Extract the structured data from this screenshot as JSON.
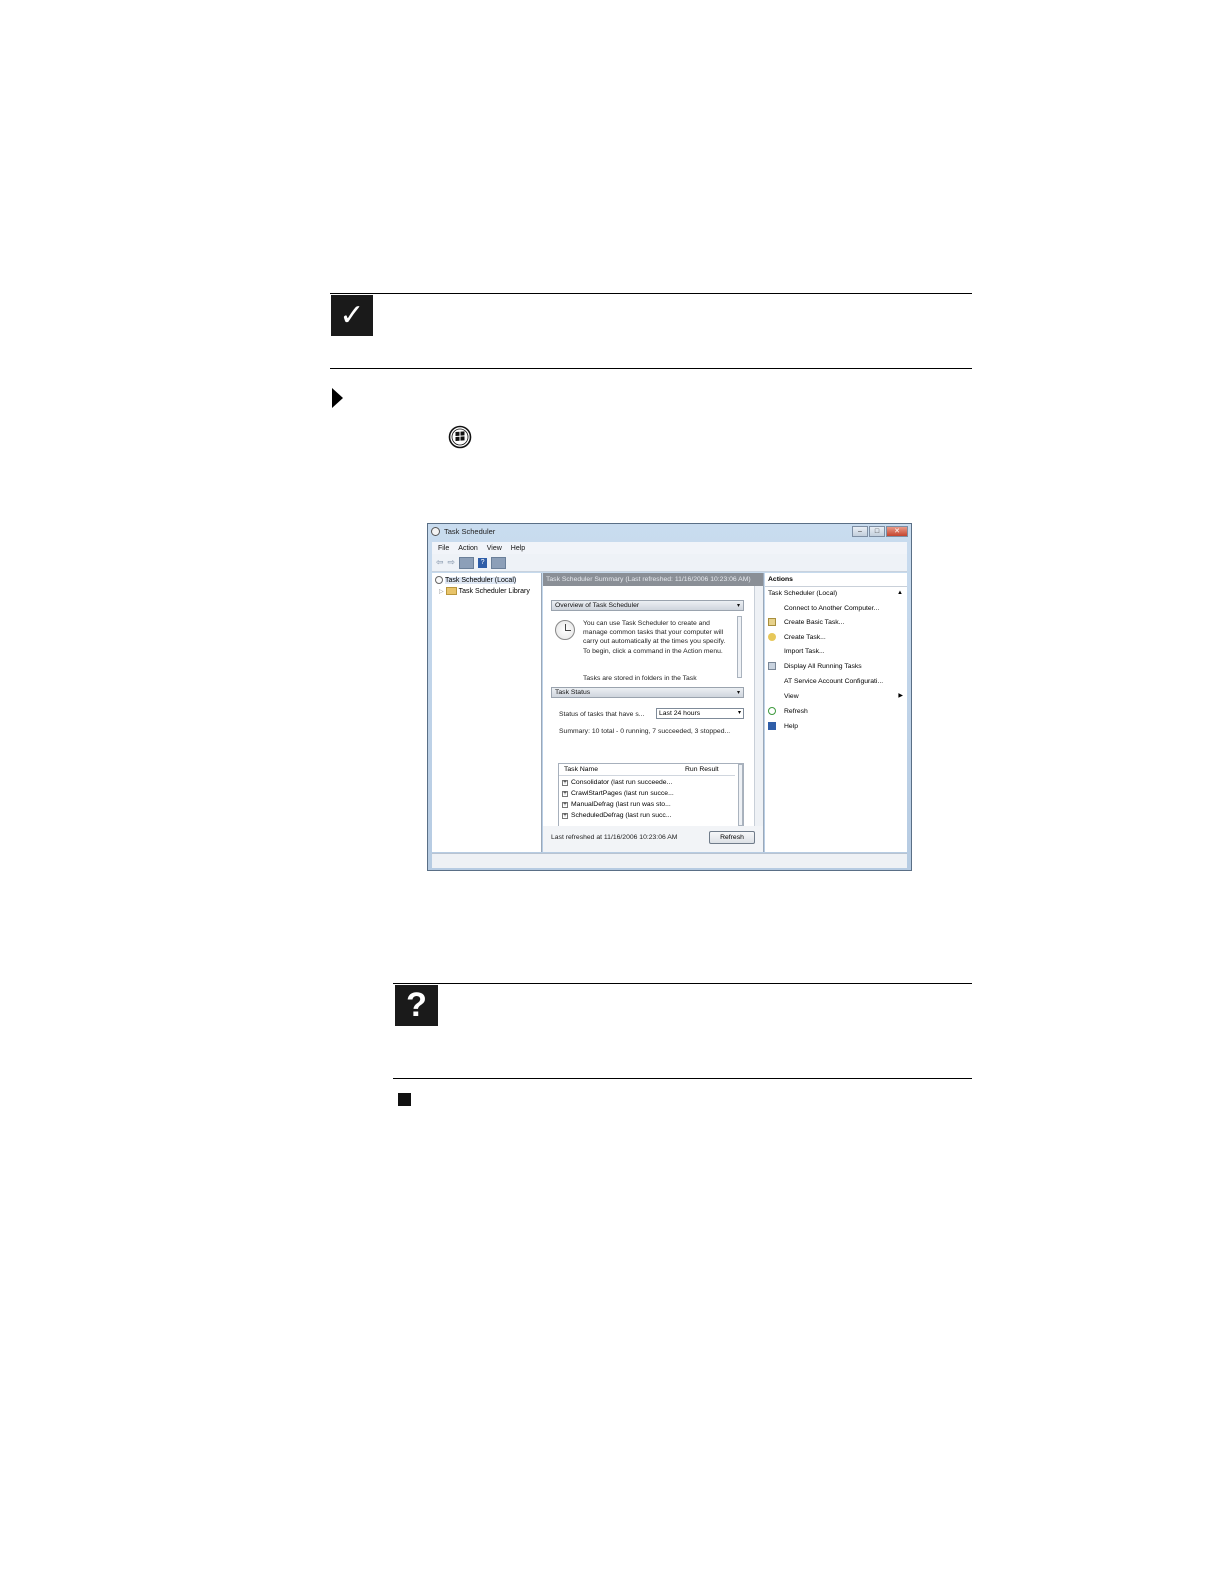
{
  "note_icon": {
    "glyph": "✓",
    "name": "checkmark-icon"
  },
  "help_icon": {
    "glyph": "?",
    "name": "question-icon"
  },
  "window": {
    "title": "Task Scheduler",
    "controls": {
      "minimize": "–",
      "maximize": "□",
      "close": "✕"
    },
    "menu": [
      "File",
      "Action",
      "View",
      "Help"
    ],
    "tree": {
      "root": "Task Scheduler (Local)",
      "child": "Task Scheduler Library"
    },
    "center": {
      "header": "Task Scheduler Summary (Last refreshed: 11/16/2006 10:23:06 AM)",
      "overview_title": "Overview of Task Scheduler",
      "overview_text": "You can use Task Scheduler to create and manage common tasks that your computer will carry out automatically at the times you specify. To begin, click a command in the Action menu.",
      "overview_text_cut": "Tasks are stored in folders in the Task",
      "status_title": "Task Status",
      "status_label": "Status of tasks that have s...",
      "status_select": "Last 24 hours",
      "summary": "Summary: 10 total - 0 running, 7 succeeded, 3 stopped...",
      "grid_headers": {
        "name": "Task Name",
        "result": "Run Result"
      },
      "tasks": [
        "Consolidator (last run succeede...",
        "CrawlStartPages (last run succe...",
        "ManualDefrag (last run was sto...",
        "ScheduledDefrag (last run succ..."
      ],
      "footer": "Last refreshed at 11/16/2006 10:23:06 AM",
      "refresh_button": "Refresh"
    },
    "actions": {
      "header": "Actions",
      "section": "Task Scheduler (Local)",
      "items": [
        "Connect to Another Computer...",
        "Create Basic Task...",
        "Create Task...",
        "Import Task...",
        "Display All Running Tasks",
        "AT Service Account Configurati...",
        "View",
        "Refresh",
        "Help"
      ]
    }
  }
}
